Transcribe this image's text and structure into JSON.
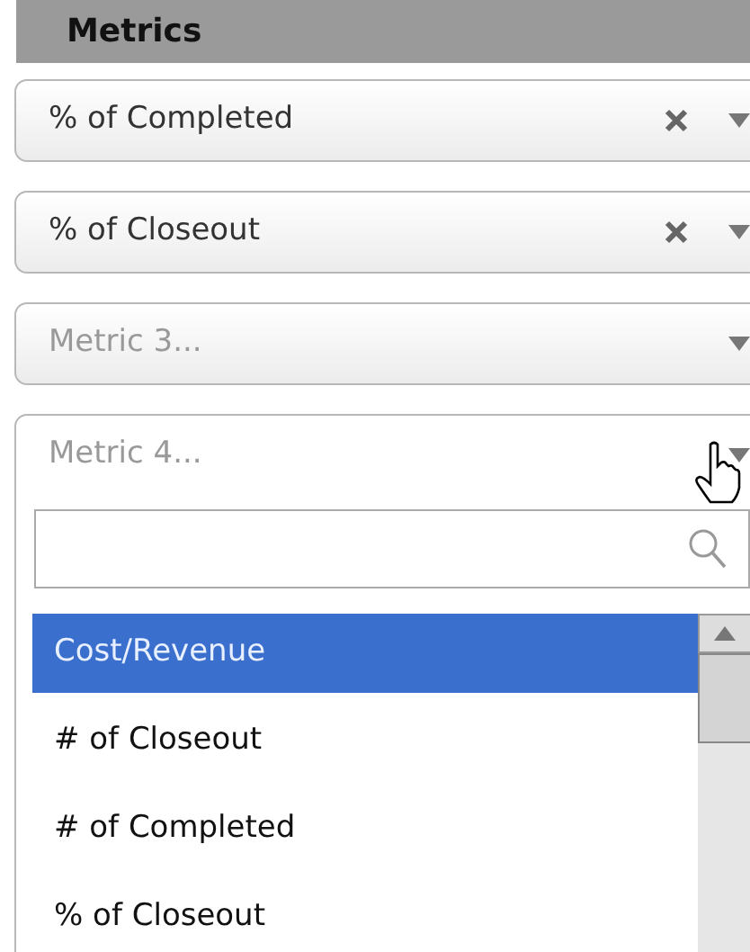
{
  "section": {
    "title": "Metrics"
  },
  "metrics": [
    {
      "value": "% of Completed",
      "open": false
    },
    {
      "value": "% of Closeout",
      "open": false
    },
    {
      "placeholder": "Metric 3...",
      "open": false
    },
    {
      "placeholder": "Metric 4...",
      "open": true,
      "options": [
        {
          "label": "Cost/Revenue",
          "selected": true
        },
        {
          "label": "# of Closeout",
          "selected": false
        },
        {
          "label": "# of Completed",
          "selected": false
        },
        {
          "label": "% of Closeout",
          "selected": false
        }
      ]
    }
  ]
}
